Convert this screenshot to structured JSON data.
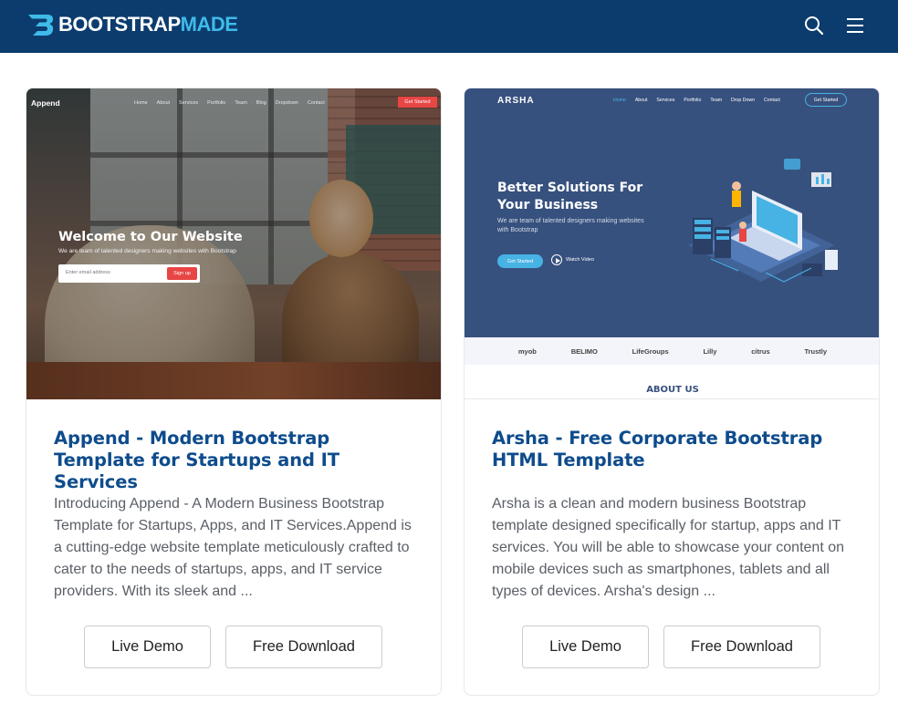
{
  "header": {
    "logo_word_white": "BOOTSTRAP",
    "logo_word_blue": "MADE",
    "search_icon": "search-icon",
    "menu_icon": "hamburger-menu-icon",
    "bg_color": "#0c3c6e",
    "accent_color": "#3fbbe9"
  },
  "cards": [
    {
      "title": "Append - Modern Bootstrap Template for Startups and IT Services",
      "description": "Introducing Append - A Modern Business Bootstrap Template for Startups, Apps, and IT Services.Append is a cutting-edge website template meticulously crafted to cater to the needs of startups, apps, and IT service providers. With its sleek and ...",
      "live_demo_label": "Live Demo",
      "free_download_label": "Free Download",
      "preview": {
        "brand": "Append",
        "nav": [
          "Home",
          "About",
          "Services",
          "Portfolio",
          "Team",
          "Blog",
          "Dropdown",
          "Contact"
        ],
        "cta": "Get Started",
        "hero_title": "Welcome to Our Website",
        "hero_subtitle": "We are team of talented designers making websites with Bootstrap",
        "email_placeholder": "Enter email address",
        "signup_label": "Sign up"
      }
    },
    {
      "title": "Arsha - Free Corporate Bootstrap HTML Template",
      "description": "Arsha is a clean and modern business Bootstrap template designed specifically for startup, apps and IT services. You will be able to showcase your content on mobile devices such as smartphones, tablets and all types of devices. Arsha's design ...",
      "live_demo_label": "Live Demo",
      "free_download_label": "Free Download",
      "preview": {
        "brand": "ARSHA",
        "nav": [
          "Home",
          "About",
          "Services",
          "Portfolio",
          "Team",
          "Drop Down",
          "Contact"
        ],
        "cta": "Get Started",
        "hero_title": "Better Solutions For Your Business",
        "hero_subtitle": "We are team of talented designers making websites with Bootstrap",
        "get_started": "Get Started",
        "watch_video": "Watch Video",
        "client_logos": [
          "myob",
          "BELIMO",
          "LifeGroups",
          "Lilly",
          "citrus",
          "Trustly"
        ],
        "section_heading": "ABOUT US"
      }
    }
  ]
}
